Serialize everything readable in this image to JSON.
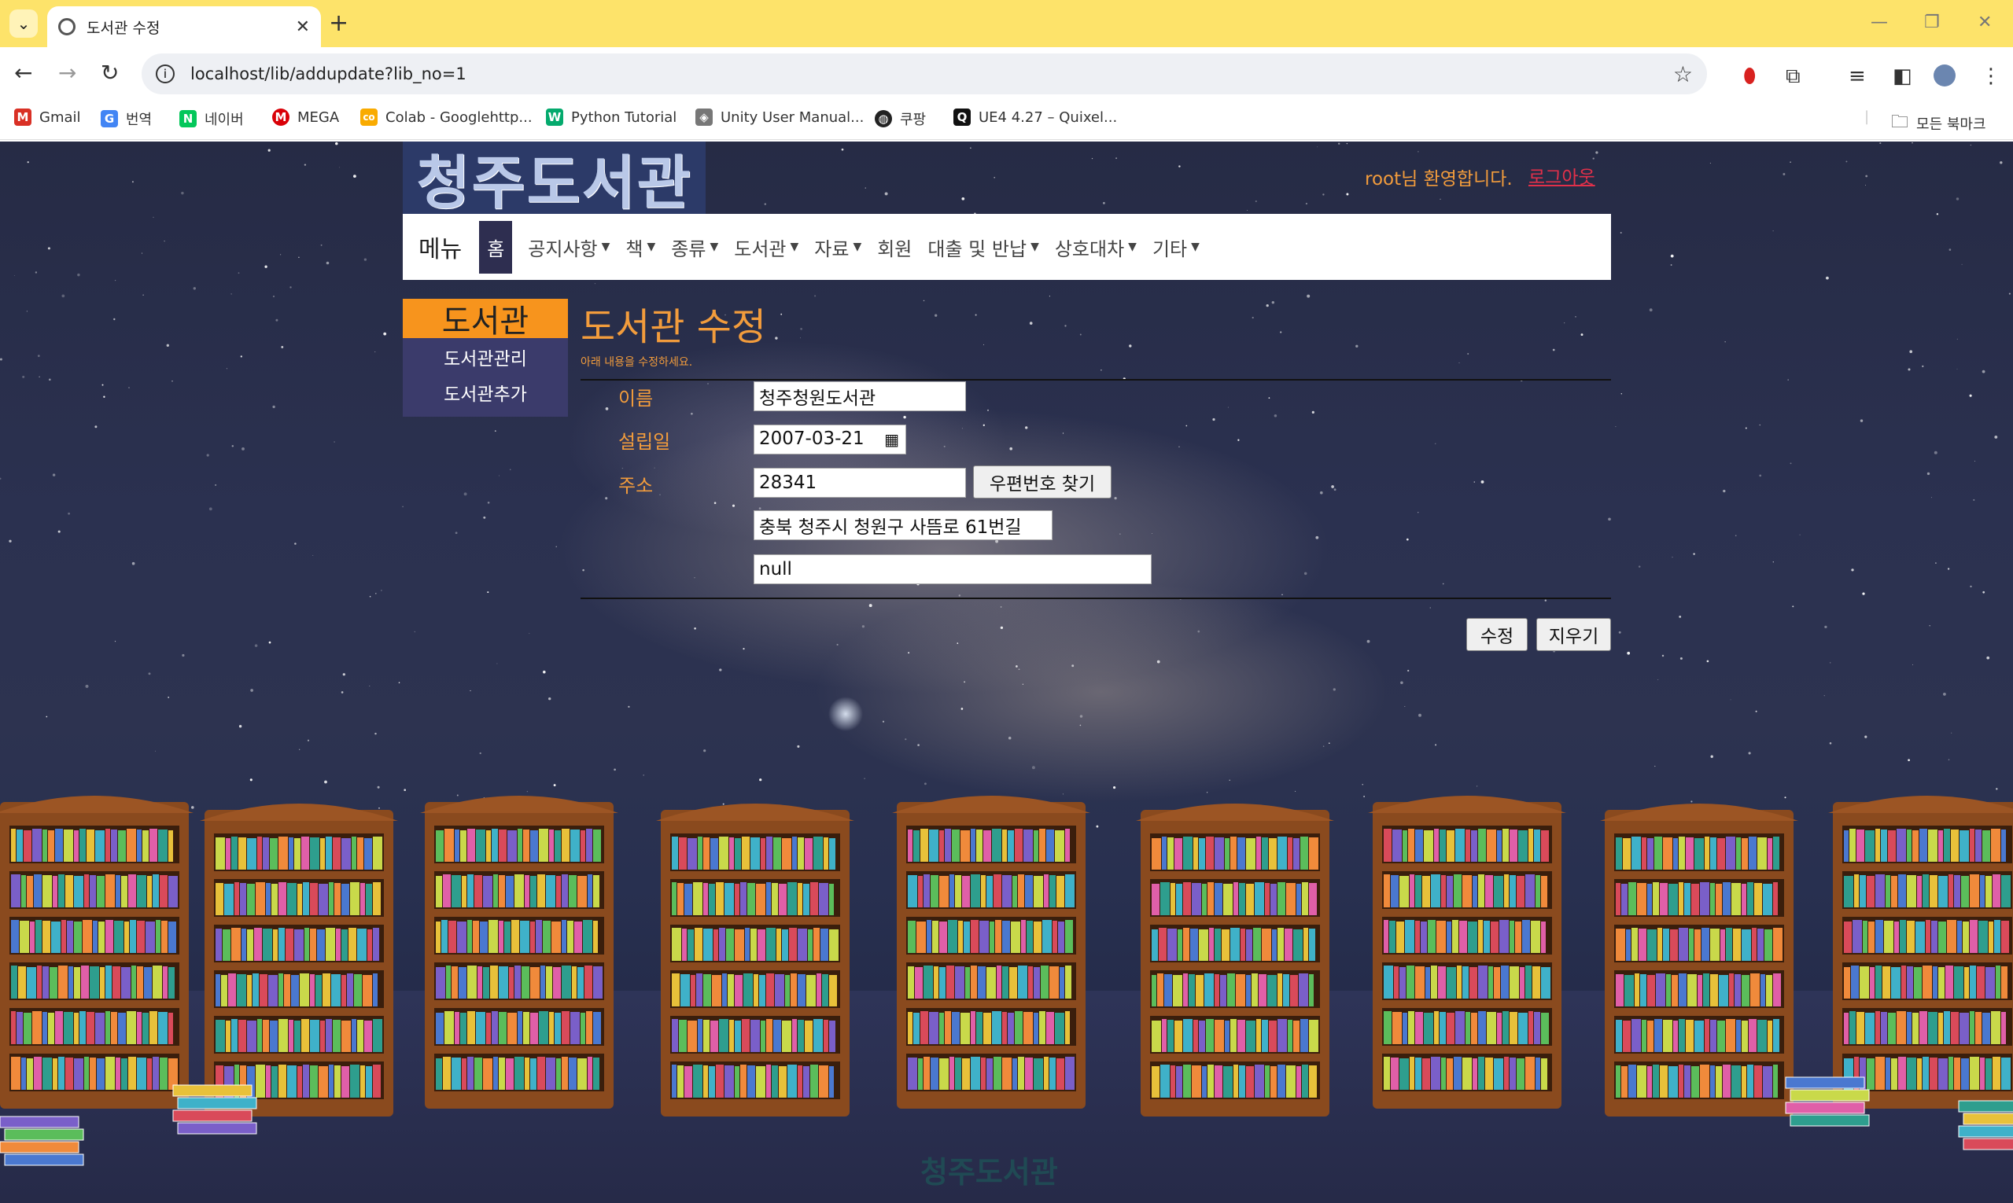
{
  "browser": {
    "tab_title": "도서관 수정",
    "url": "localhost/lib/addupdate?lib_no=1",
    "bookmarks": [
      {
        "label": "Gmail",
        "icon": "gmail-icon",
        "color": "#d93025",
        "glyph": "M"
      },
      {
        "label": "번역",
        "icon": "translate-icon",
        "color": "#4285f4",
        "glyph": "G"
      },
      {
        "label": "네이버",
        "icon": "naver-icon",
        "color": "#03c75a",
        "glyph": "N"
      },
      {
        "label": "MEGA",
        "icon": "mega-icon",
        "color": "#d90007",
        "glyph": "M"
      },
      {
        "label": "Colab - Googlehttp...",
        "icon": "colab-icon",
        "color": "#f9ab00",
        "glyph": "co"
      },
      {
        "label": "Python Tutorial",
        "icon": "w3schools-icon",
        "color": "#04aa6d",
        "glyph": "W"
      },
      {
        "label": "Unity User Manual...",
        "icon": "unity-icon",
        "color": "#555555",
        "glyph": "◈"
      },
      {
        "label": "쿠팡",
        "icon": "globe-icon",
        "color": "#222222",
        "glyph": "◍"
      },
      {
        "label": "UE4 4.27 – Quixel...",
        "icon": "quixel-icon",
        "color": "#111111",
        "glyph": "Q"
      }
    ],
    "all_bookmarks": "모든 북마크"
  },
  "site": {
    "logo_text": "청주도서관",
    "welcome": "root님 환영합니다.",
    "logout": "로그아웃",
    "footer_logo": "청주도서관"
  },
  "nav": {
    "brand": "메뉴",
    "items": [
      {
        "label": "홈",
        "dropdown": false
      },
      {
        "label": "공지사항",
        "dropdown": true
      },
      {
        "label": "책",
        "dropdown": true
      },
      {
        "label": "종류",
        "dropdown": true
      },
      {
        "label": "도서관",
        "dropdown": true
      },
      {
        "label": "자료",
        "dropdown": true
      },
      {
        "label": "회원",
        "dropdown": false
      },
      {
        "label": "대출 및 반납",
        "dropdown": true
      },
      {
        "label": "상호대차",
        "dropdown": true
      },
      {
        "label": "기타",
        "dropdown": true
      }
    ]
  },
  "sidebar": {
    "title": "도서관",
    "links": [
      "도서관관리",
      "도서관추가"
    ]
  },
  "form": {
    "title": "도서관 수정",
    "subtitle": "아래 내용을 수정하세요.",
    "name_label": "이름",
    "name_value": "청주청원도서관",
    "founded_label": "설립일",
    "founded_value": "2007-03-21",
    "address_label": "주소",
    "zipcode_value": "28341",
    "zipcode_button": "우편번호 찾기",
    "address_value": "충북 청주시 청원구 사뜸로 61번길",
    "address_detail_value": "null",
    "submit_button": "수정",
    "clear_button": "지우기"
  },
  "colors": {
    "accent_orange": "#f29c3c",
    "sidebar_head": "#f7941d",
    "sidebar_bg": "#3b3b6b",
    "nav_active": "#2e2e50",
    "logout_red": "#e2304a",
    "tabstrip_yellow": "#fde36a"
  }
}
